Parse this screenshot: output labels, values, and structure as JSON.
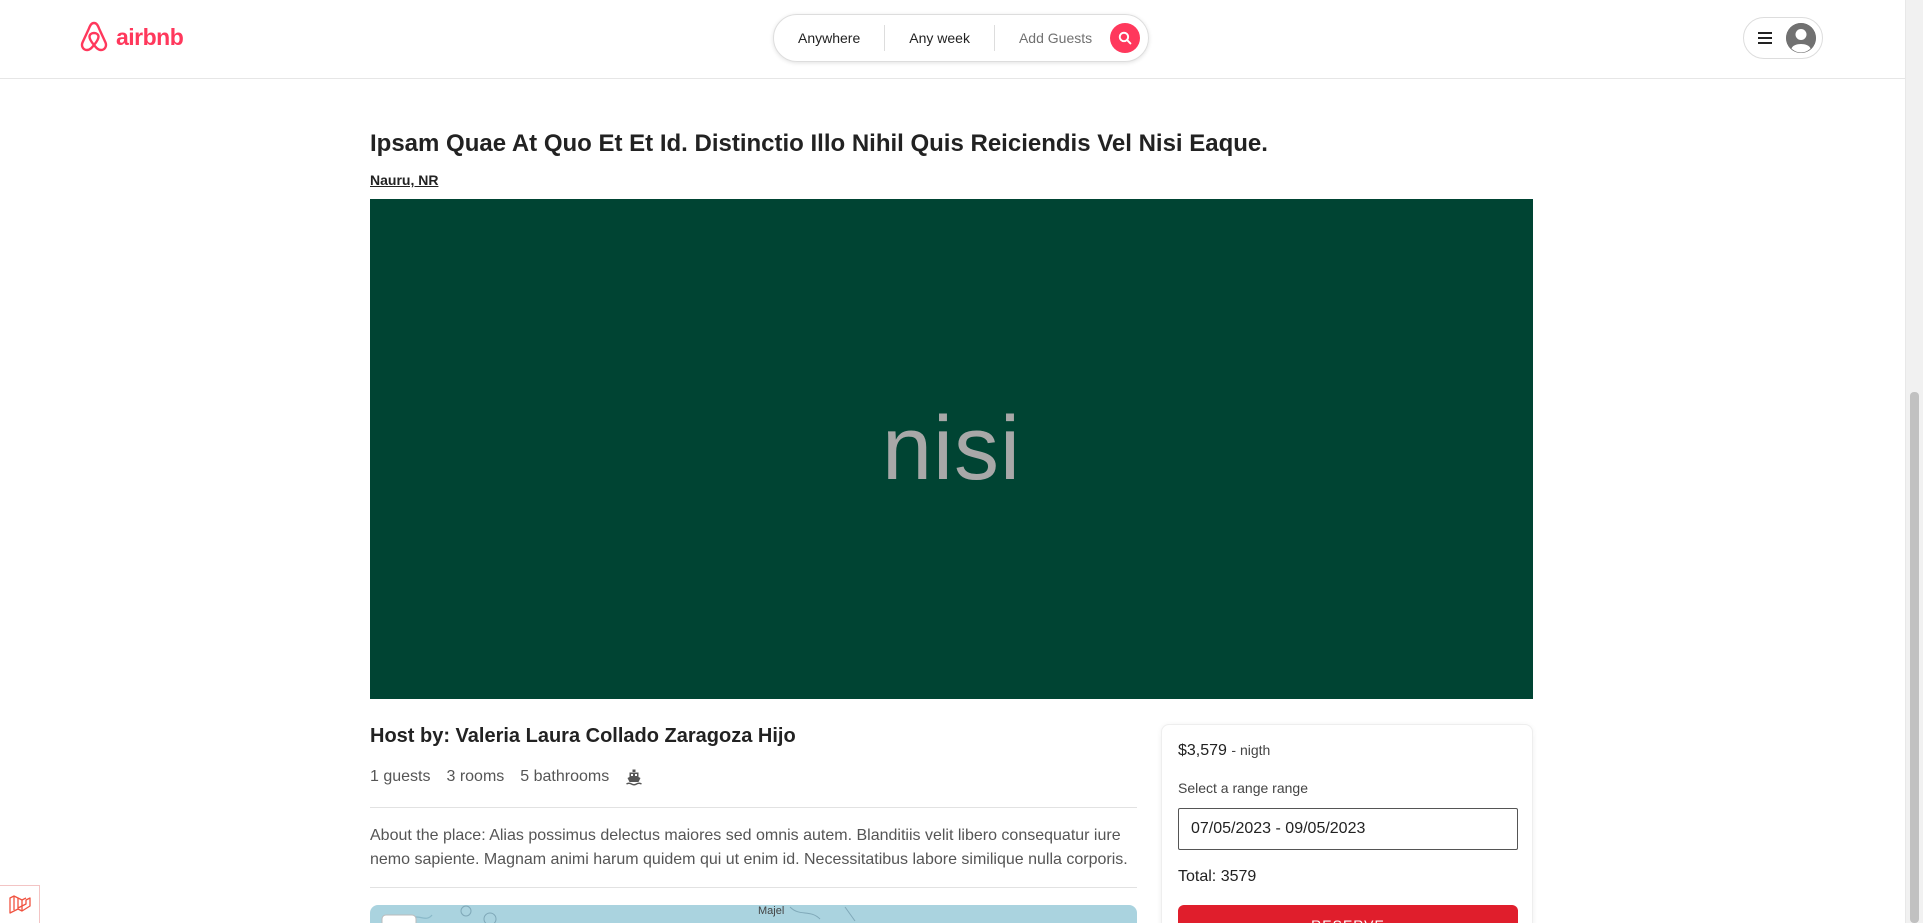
{
  "header": {
    "logo_text": "airbnb",
    "brand_color": "#ff385c",
    "search": {
      "location": "Anywhere",
      "week": "Any week",
      "guests": "Add Guests"
    },
    "icons": {
      "search": "search-icon",
      "menu": "hamburger-icon",
      "avatar": "user-avatar-icon"
    }
  },
  "listing": {
    "title": "Ipsam Quae At Quo Et Et Id. Distinctio Illo Nihil Quis Reiciendis Vel Nisi Eaque.",
    "location": "Nauru, NR",
    "image_text": "nisi",
    "image_bg_color": "#004433",
    "host": "Host by: Valeria Laura Collado Zaragoza Hijo",
    "facts": {
      "guests": "1 guests",
      "rooms": "3 rooms",
      "bathrooms": "5 bathrooms",
      "amenity_icon": "ship-icon"
    },
    "about": "About the place: Alias possimus delectus maiores sed omnis autem. Blanditiis velit libero consequatur iure nemo sapiente. Magnam animi harum quidem qui ut enim id. Necessitatibus labore similique nulla corporis.",
    "map_label": "Majel"
  },
  "booking": {
    "price": "$3,579",
    "price_unit": "- nigth",
    "range_label": "Select a range range",
    "date_range": "07/05/2023 - 09/05/2023",
    "total": "Total: 3579",
    "reserve_label": "RESERVE",
    "reserve_color": "#e01e2c"
  }
}
